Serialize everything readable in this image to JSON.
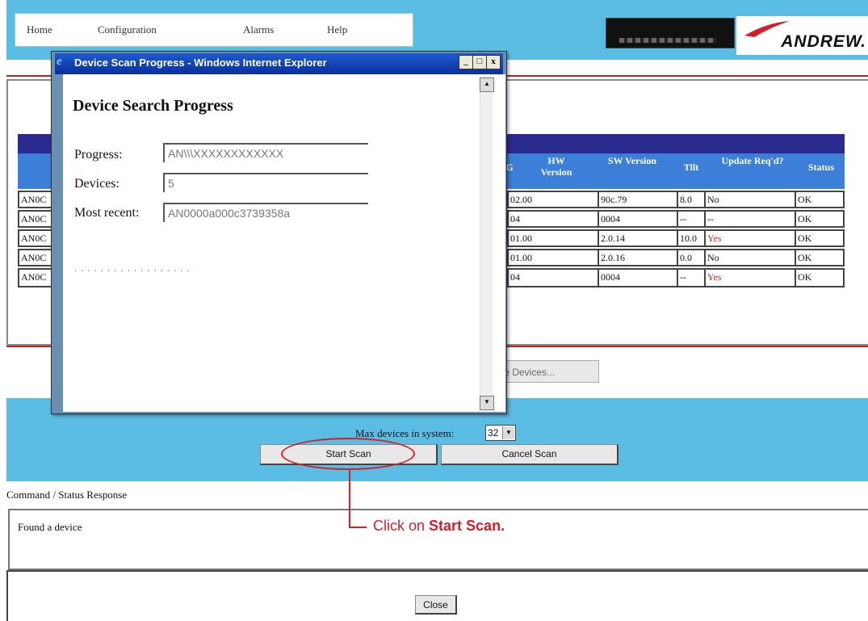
{
  "menu": {
    "items": [
      "Home",
      "Configuration",
      "Alarms",
      "Help"
    ]
  },
  "brand": {
    "logo_text": "ANDREW."
  },
  "table": {
    "columns": [
      "",
      "G",
      "HW Version",
      "SW Version",
      "Tilt",
      "Update Req'd?",
      "Status"
    ],
    "rows": [
      {
        "id": "AN0C",
        "hw": "02.00",
        "sw": "90c.79",
        "tilt": "8.0",
        "update": "No",
        "status": "OK"
      },
      {
        "id": "AN0C",
        "hw": "04",
        "sw": "0004",
        "tilt": "--",
        "update": "--",
        "status": "OK"
      },
      {
        "id": "AN0C",
        "hw": "01.00",
        "sw": "2.0.14",
        "tilt": "10.0",
        "update": "Yes",
        "status": "OK"
      },
      {
        "id": "AN0C",
        "hw": "01.00",
        "sw": "2.0.16",
        "tilt": "0.0",
        "update": "No",
        "status": "OK"
      },
      {
        "id": "AN0C",
        "hw": "04",
        "sw": "0004",
        "tilt": "--",
        "update": "Yes",
        "status": "OK"
      }
    ]
  },
  "update_button": "te Devices...",
  "controls": {
    "max_devices_label": "Max devices in system:",
    "max_devices_value": "32",
    "start_scan": "Start Scan",
    "cancel_scan": "Cancel Scan"
  },
  "status": {
    "label": "Command / Status Response",
    "text": "Found a device"
  },
  "close_button": "Close",
  "callout": {
    "prefix": "Click on ",
    "bold": "Start Scan."
  },
  "popup": {
    "window_title": "Device Scan Progress - Windows Internet Explorer",
    "heading": "Device Search Progress",
    "progress_label": "Progress:",
    "progress_value": "AN\\\\\\XXXXXXXXXXXX",
    "devices_label": "Devices:",
    "devices_value": "5",
    "recent_label": "Most recent:",
    "recent_value": "AN0000a000c3739358a",
    "dots": "..................",
    "win_minimize": "_",
    "win_maximize": "□",
    "win_close": "x"
  },
  "colors": {
    "banner_blue": "#5bbde4",
    "header_blue": "#3c7fd9",
    "callout_red": "#d21f2b",
    "yes_red": "#dd2222"
  }
}
